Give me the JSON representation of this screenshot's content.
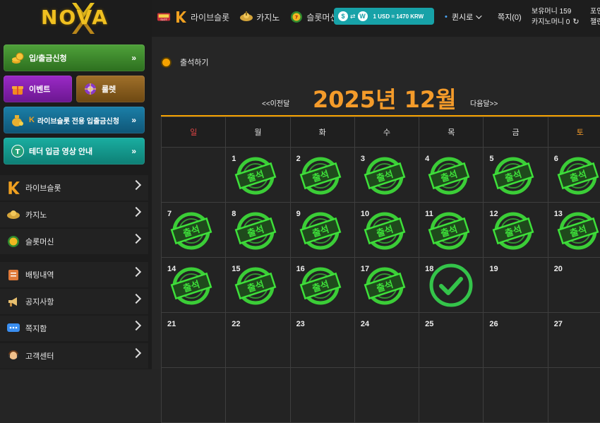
{
  "brand": {
    "logo_text": "NOVA"
  },
  "nav": [
    {
      "label": "라이브슬롯",
      "icon": "live-slot-icon"
    },
    {
      "label": "카지노",
      "icon": "casino-icon"
    },
    {
      "label": "슬롯머신",
      "icon": "slot-machine-icon"
    }
  ],
  "rate": {
    "text": "1 USD = 1470 KRW",
    "from": "$",
    "to": "W"
  },
  "topbar": {
    "language": "퀸시로",
    "messages": "쪽지(0)",
    "money_line1": "보유머니 159",
    "money_line2": "카지노머니 0",
    "point_line1": "포인",
    "point_line2": "챌린"
  },
  "sidebar": {
    "deposit": "입/출금신청",
    "event": "이벤트",
    "roulette": "룰렛",
    "live_slot_deposit": "라이브슬롯 전용 입출금신청",
    "tether_guide": "테더 입금 영상 안내",
    "menu": [
      {
        "label": "라이브슬롯",
        "icon": "live-slot-icon"
      },
      {
        "label": "카지노",
        "icon": "casino-icon"
      },
      {
        "label": "슬롯머신",
        "icon": "slot-machine-icon"
      },
      {
        "label": "배팅내역",
        "icon": "betting-history-icon"
      },
      {
        "label": "공지사항",
        "icon": "megaphone-icon"
      },
      {
        "label": "쪽지함",
        "icon": "message-icon"
      },
      {
        "label": "고객센터",
        "icon": "support-icon"
      }
    ]
  },
  "attendance": {
    "label": "출석하기",
    "title": "2025년 12월",
    "prev": "<<이전달",
    "next": "다음달>>",
    "weekdays": [
      "일",
      "월",
      "화",
      "수",
      "목",
      "금",
      "토"
    ],
    "stamp_text": "출석",
    "colors": {
      "accent": "#f49b2a",
      "stamp": "#3ee03a",
      "check": "#34c44a",
      "sunday": "#e34545"
    },
    "weeks": [
      [
        {
          "day": ""
        },
        {
          "day": "1",
          "state": "stamp"
        },
        {
          "day": "2",
          "state": "stamp"
        },
        {
          "day": "3",
          "state": "stamp"
        },
        {
          "day": "4",
          "state": "stamp"
        },
        {
          "day": "5",
          "state": "stamp"
        },
        {
          "day": "6",
          "state": "stamp"
        }
      ],
      [
        {
          "day": "7",
          "state": "stamp"
        },
        {
          "day": "8",
          "state": "stamp"
        },
        {
          "day": "9",
          "state": "stamp"
        },
        {
          "day": "10",
          "state": "stamp"
        },
        {
          "day": "11",
          "state": "stamp"
        },
        {
          "day": "12",
          "state": "stamp"
        },
        {
          "day": "13",
          "state": "stamp"
        }
      ],
      [
        {
          "day": "14",
          "state": "stamp"
        },
        {
          "day": "15",
          "state": "stamp"
        },
        {
          "day": "16",
          "state": "stamp"
        },
        {
          "day": "17",
          "state": "stamp"
        },
        {
          "day": "18",
          "state": "today"
        },
        {
          "day": "19"
        },
        {
          "day": "20"
        }
      ],
      [
        {
          "day": "21"
        },
        {
          "day": "22"
        },
        {
          "day": "23"
        },
        {
          "day": "24"
        },
        {
          "day": "25"
        },
        {
          "day": "26"
        },
        {
          "day": "27"
        }
      ],
      [
        {
          "day": ""
        },
        {
          "day": ""
        },
        {
          "day": ""
        },
        {
          "day": ""
        },
        {
          "day": ""
        },
        {
          "day": ""
        },
        {
          "day": ""
        }
      ]
    ]
  }
}
